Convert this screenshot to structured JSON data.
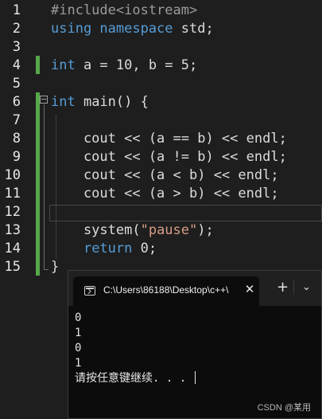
{
  "editor": {
    "lines": [
      {
        "num": "1",
        "tokens": [
          {
            "t": "#include<iostream>",
            "c": "#9b9b9b"
          }
        ]
      },
      {
        "num": "2",
        "tokens": [
          {
            "t": "using namespace",
            "c": "#569cd6"
          },
          {
            "t": " std;",
            "c": "#dcdcdc"
          }
        ]
      },
      {
        "num": "3",
        "tokens": []
      },
      {
        "num": "4",
        "tokens": [
          {
            "t": "int",
            "c": "#569cd6"
          },
          {
            "t": " a = 10, b = 5;",
            "c": "#dcdcdc"
          }
        ]
      },
      {
        "num": "5",
        "tokens": []
      },
      {
        "num": "6",
        "tokens": [
          {
            "t": "int",
            "c": "#569cd6"
          },
          {
            "t": " main() {",
            "c": "#dcdcdc"
          }
        ]
      },
      {
        "num": "7",
        "tokens": []
      },
      {
        "num": "8",
        "tokens": [
          {
            "t": "    cout << (a == b) << endl;",
            "c": "#dcdcdc"
          }
        ]
      },
      {
        "num": "9",
        "tokens": [
          {
            "t": "    cout << (a != b) << endl;",
            "c": "#dcdcdc"
          }
        ]
      },
      {
        "num": "10",
        "tokens": [
          {
            "t": "    cout << (a < b) << endl;",
            "c": "#dcdcdc"
          }
        ]
      },
      {
        "num": "11",
        "tokens": [
          {
            "t": "    cout << (a > b) << endl;",
            "c": "#dcdcdc"
          }
        ]
      },
      {
        "num": "12",
        "tokens": []
      },
      {
        "num": "13",
        "tokens": [
          {
            "t": "    system(",
            "c": "#dcdcdc"
          },
          {
            "t": "\"pause\"",
            "c": "#d69d85"
          },
          {
            "t": ");",
            "c": "#dcdcdc"
          }
        ]
      },
      {
        "num": "14",
        "tokens": [
          {
            "t": "    ",
            "c": "#dcdcdc"
          },
          {
            "t": "return",
            "c": "#569cd6"
          },
          {
            "t": " 0;",
            "c": "#dcdcdc"
          }
        ]
      },
      {
        "num": "15",
        "tokens": [
          {
            "t": "}",
            "c": "#dcdcdc"
          }
        ]
      }
    ]
  },
  "console": {
    "tab_title": "C:\\Users\\86188\\Desktop\\c++\\",
    "close_glyph": "✕",
    "new_tab_glyph": "+",
    "dropdown_glyph": "⌄",
    "output_lines": [
      "0",
      "1",
      "0",
      "1",
      "请按任意键继续. . . "
    ]
  },
  "watermark": "CSDN @某用"
}
